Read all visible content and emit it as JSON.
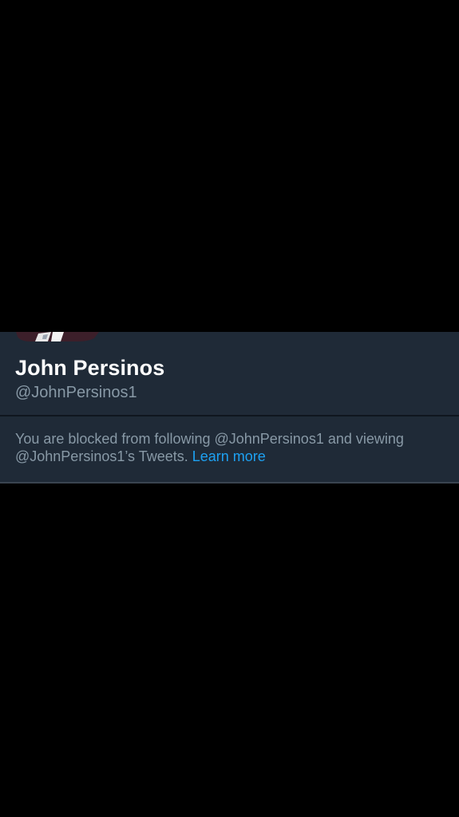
{
  "profile": {
    "name": "John Persinos",
    "handle": "@JohnPersinos1"
  },
  "blocked_notice": {
    "text": "You are blocked from following @JohnPersinos1 and viewing @JohnPersinos1’s Tweets.",
    "link_label": "Learn more"
  },
  "colors": {
    "background": "#000000",
    "panel": "#1f2a37",
    "name_text": "#ffffff",
    "secondary_text": "#8899a6",
    "link": "#1da1f2"
  }
}
